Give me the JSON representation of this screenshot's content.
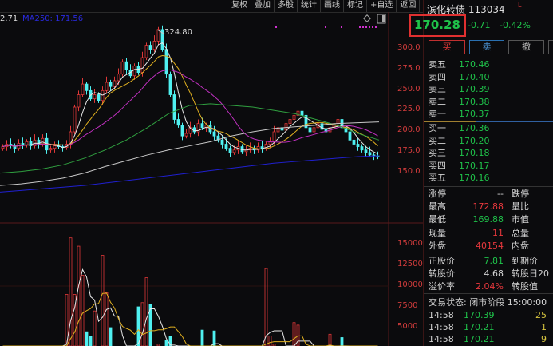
{
  "toolbar": [
    "复权",
    "叠加",
    "多股",
    "统计",
    "画线",
    "标记",
    "+自选",
    "返回"
  ],
  "legend": {
    "prev_value": "2.71",
    "ma250": "MA250: 171.56"
  },
  "price_axis": [
    "300.0",
    "275.0",
    "250.0",
    "225.0",
    "200.0",
    "175.0",
    "150.0"
  ],
  "volume_axis": [
    "15000",
    "12500",
    "10000",
    "7500",
    "5000"
  ],
  "high_annotation": "324.80",
  "colors": {
    "up": "#e03838",
    "down": "#4ff0f0",
    "ma5": "#e8e8e8",
    "ma10": "#e0b020",
    "ma20": "#c030c0",
    "ma60": "#30a040",
    "ma120": "#c8c8c8",
    "ma250": "#2020d0"
  },
  "chart_data": {
    "type": "candlestick",
    "closes": [
      182,
      185,
      183,
      180,
      186,
      184,
      188,
      183,
      190,
      185,
      192,
      178,
      180,
      183,
      182,
      181,
      185,
      200,
      230,
      245,
      258,
      250,
      240,
      245,
      238,
      250,
      260,
      255,
      262,
      270,
      285,
      275,
      268,
      280,
      272,
      290,
      305,
      300,
      310,
      324,
      300,
      270,
      245,
      215,
      208,
      195,
      198,
      205,
      200,
      210,
      205,
      208,
      200,
      195,
      190,
      185,
      180,
      175,
      178,
      182,
      176,
      178,
      180,
      178,
      182,
      180,
      185,
      188,
      200,
      205,
      202,
      210,
      215,
      220,
      225,
      220,
      205,
      200,
      205,
      210,
      203,
      200,
      205,
      210,
      215,
      205,
      200,
      190,
      185,
      182,
      178,
      175,
      172,
      171,
      170
    ],
    "volumes": [
      1500,
      1500,
      1500,
      1500,
      1500,
      1500,
      1500,
      1500,
      1500,
      1500,
      1500,
      1500,
      1500,
      1500,
      1500,
      1500,
      9000,
      15800,
      9000,
      14800,
      11300,
      4500,
      4000,
      7000,
      2000,
      13700,
      9200,
      5000,
      2000,
      2000,
      2000,
      2000,
      2000,
      2000,
      7500,
      8000,
      11000,
      7800,
      2000,
      3000,
      2000,
      3500,
      4000,
      2000,
      2000,
      2000,
      2000,
      2000,
      2000,
      2000,
      4700,
      2000,
      2000,
      4600,
      2000,
      2000,
      2000,
      2000,
      2000,
      2000,
      2000,
      2000,
      2000,
      2000,
      2000,
      2000,
      12100,
      4000,
      3000,
      2000,
      2000,
      2000,
      2000,
      5600,
      5300,
      2000,
      2000,
      2000,
      2000,
      2000,
      2000,
      2000,
      4200,
      2000,
      2000,
      3800,
      2000,
      2000,
      2000,
      2000,
      2000,
      2000,
      2000,
      2000,
      2000
    ],
    "ma60": [
      150,
      152,
      155,
      160,
      168,
      178,
      190,
      205,
      222,
      232,
      234,
      232,
      230,
      226,
      222,
      215,
      208,
      198,
      190
    ],
    "ma120": [
      135,
      137,
      140,
      144,
      150,
      158,
      165,
      172,
      178,
      183,
      188,
      195,
      200,
      204,
      206,
      208,
      210,
      211,
      212
    ],
    "ma250": [
      127,
      129,
      131,
      133,
      135,
      138,
      141,
      144,
      147,
      150,
      153,
      156,
      159,
      162,
      164,
      166,
      168,
      170,
      171
    ]
  },
  "quote": {
    "name": "滨化转债 113034",
    "flag": "L",
    "price": "170.28",
    "change": "-0.71",
    "pct": "-0.42%"
  },
  "buttons": {
    "buy": "买",
    "sell": "卖",
    "cancel": "撤"
  },
  "asks": [
    {
      "label": "卖五",
      "price": "170.46"
    },
    {
      "label": "卖四",
      "price": "170.40"
    },
    {
      "label": "卖三",
      "price": "170.39"
    },
    {
      "label": "卖二",
      "price": "170.38"
    },
    {
      "label": "卖一",
      "price": "170.37"
    }
  ],
  "bids": [
    {
      "label": "买一",
      "price": "170.36"
    },
    {
      "label": "买二",
      "price": "170.20"
    },
    {
      "label": "买三",
      "price": "170.18"
    },
    {
      "label": "买四",
      "price": "170.17"
    },
    {
      "label": "买五",
      "price": "170.16"
    }
  ],
  "stats": [
    {
      "l": "涨停",
      "v": "--",
      "r": "跌停",
      "c": "w"
    },
    {
      "l": "最高",
      "v": "172.88",
      "r": "量比",
      "c": "r"
    },
    {
      "l": "最低",
      "v": "169.88",
      "r": "市值",
      "c": "g"
    },
    {
      "l": "现量",
      "v": "11",
      "r": "总量",
      "c": "r"
    },
    {
      "l": "外盘",
      "v": "40154",
      "r": "内盘",
      "c": "r"
    }
  ],
  "bond": [
    {
      "l": "正股价",
      "v": "7.81",
      "r": "到期价",
      "c": "g"
    },
    {
      "l": "转股价",
      "v": "4.68",
      "r": "转股日20",
      "c": "w"
    },
    {
      "l": "溢价率",
      "v": "2.04%",
      "r": "转股值",
      "c": "r"
    }
  ],
  "trade_status": "交易状态: 闭市阶段 15:00:00",
  "ticks": [
    {
      "t": "14:58",
      "p": "170.39",
      "q": "25"
    },
    {
      "t": "14:58",
      "p": "170.21",
      "q": "1"
    },
    {
      "t": "14:58",
      "p": "170.21",
      "q": "9"
    }
  ]
}
